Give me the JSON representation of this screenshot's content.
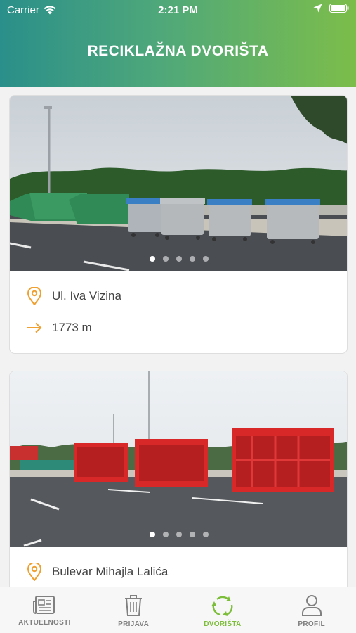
{
  "status_bar": {
    "carrier": "Carrier",
    "time": "2:21 PM"
  },
  "header": {
    "title": "RECIKLAŽNA DVORIŠTA"
  },
  "yards": [
    {
      "address": "Ul. Iva Vizina",
      "distance": "1773 m",
      "photo_count": 5,
      "active_photo": 1
    },
    {
      "address": "Bulevar Mihajla Lalića",
      "photo_count": 5,
      "active_photo": 1
    }
  ],
  "tabs": [
    {
      "label": "AKTUELNOSTI",
      "icon": "newspaper-icon",
      "active": false
    },
    {
      "label": "PRIJAVA",
      "icon": "trash-can-icon",
      "active": false
    },
    {
      "label": "DVORIŠTA",
      "icon": "recycle-icon",
      "active": true
    },
    {
      "label": "PROFIL",
      "icon": "user-icon",
      "active": false
    }
  ],
  "colors": {
    "header_start": "#2a8f8a",
    "header_end": "#7cbd4a",
    "accent_orange": "#f0a030",
    "active_tab": "#7cbd3a",
    "inactive_tab": "#808080"
  }
}
